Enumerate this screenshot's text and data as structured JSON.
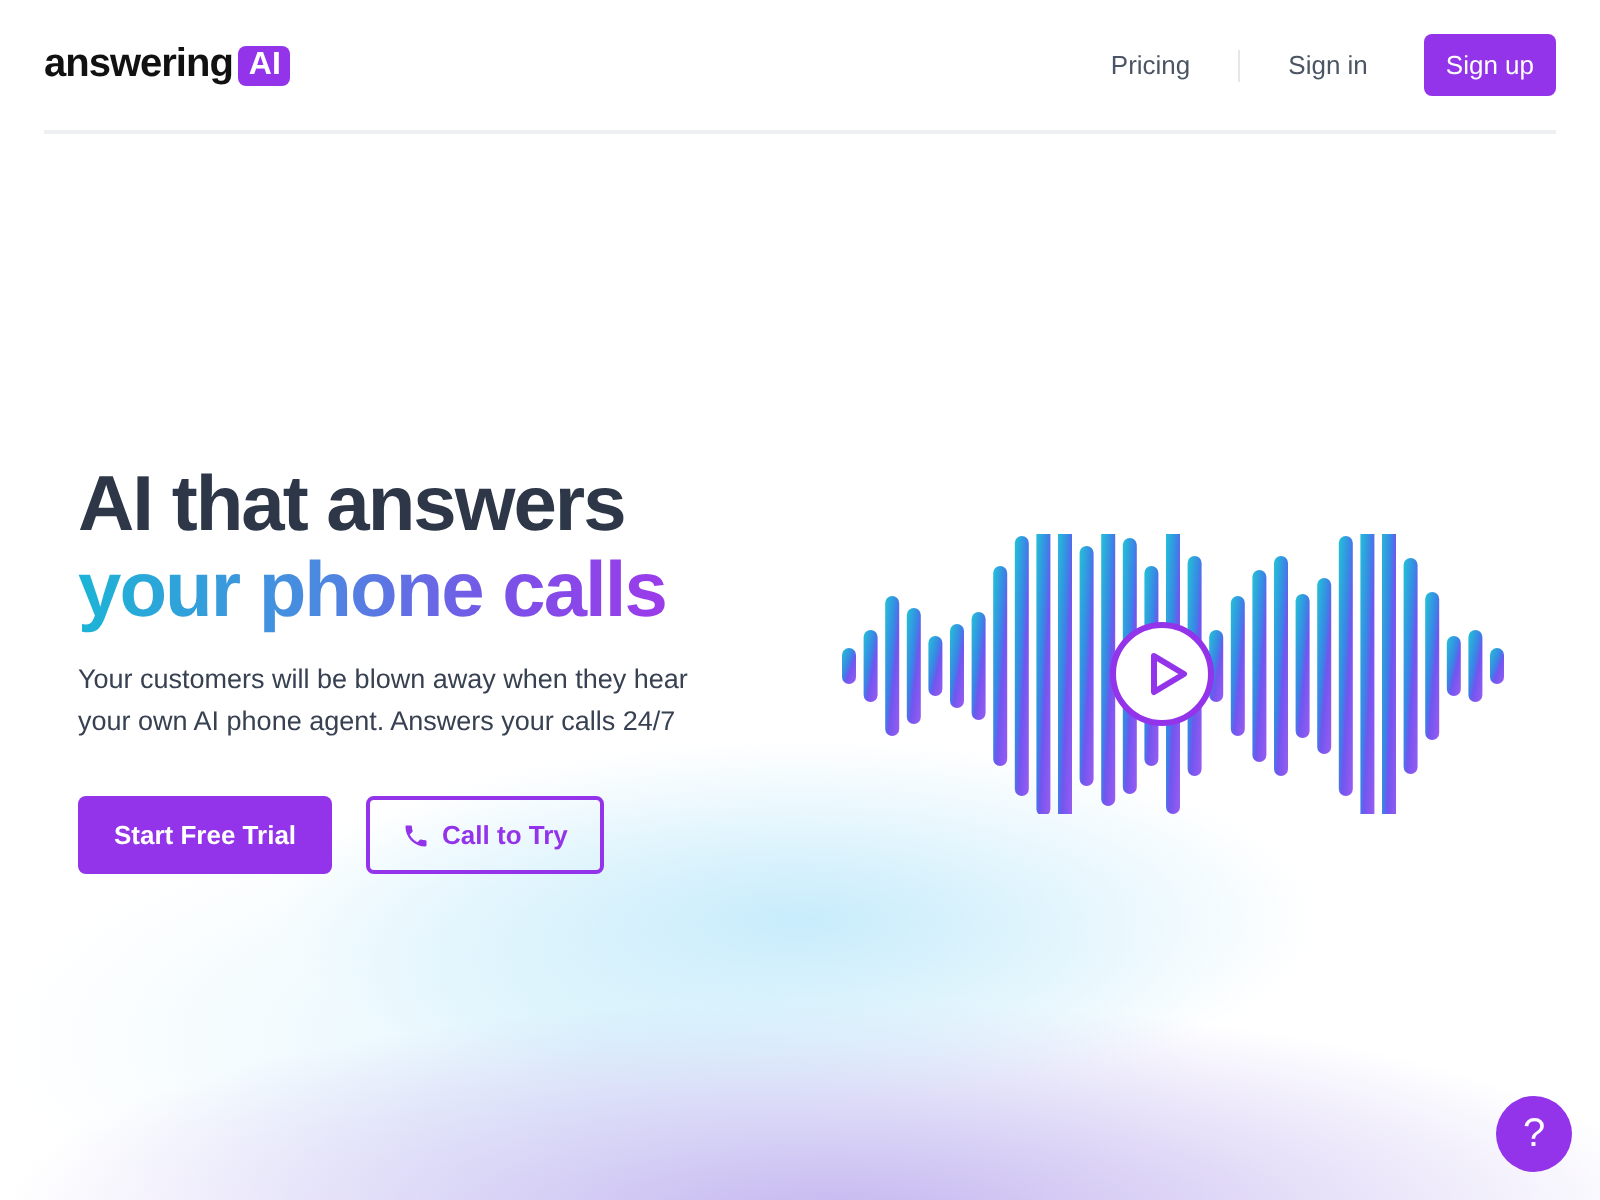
{
  "logo": {
    "word": "answering",
    "badge": "AI"
  },
  "nav": {
    "links": [
      "Pricing",
      "Sign in"
    ],
    "signup": "Sign up"
  },
  "hero": {
    "title_line_1": "AI that answers",
    "title_line_2": "your phone calls",
    "subtitle": "Your customers will be blown away when they hear your own AI phone agent. Answers your calls 24/7",
    "primary_button": "Start Free Trial",
    "secondary_button": "Call to Try"
  },
  "help_button": "?"
}
